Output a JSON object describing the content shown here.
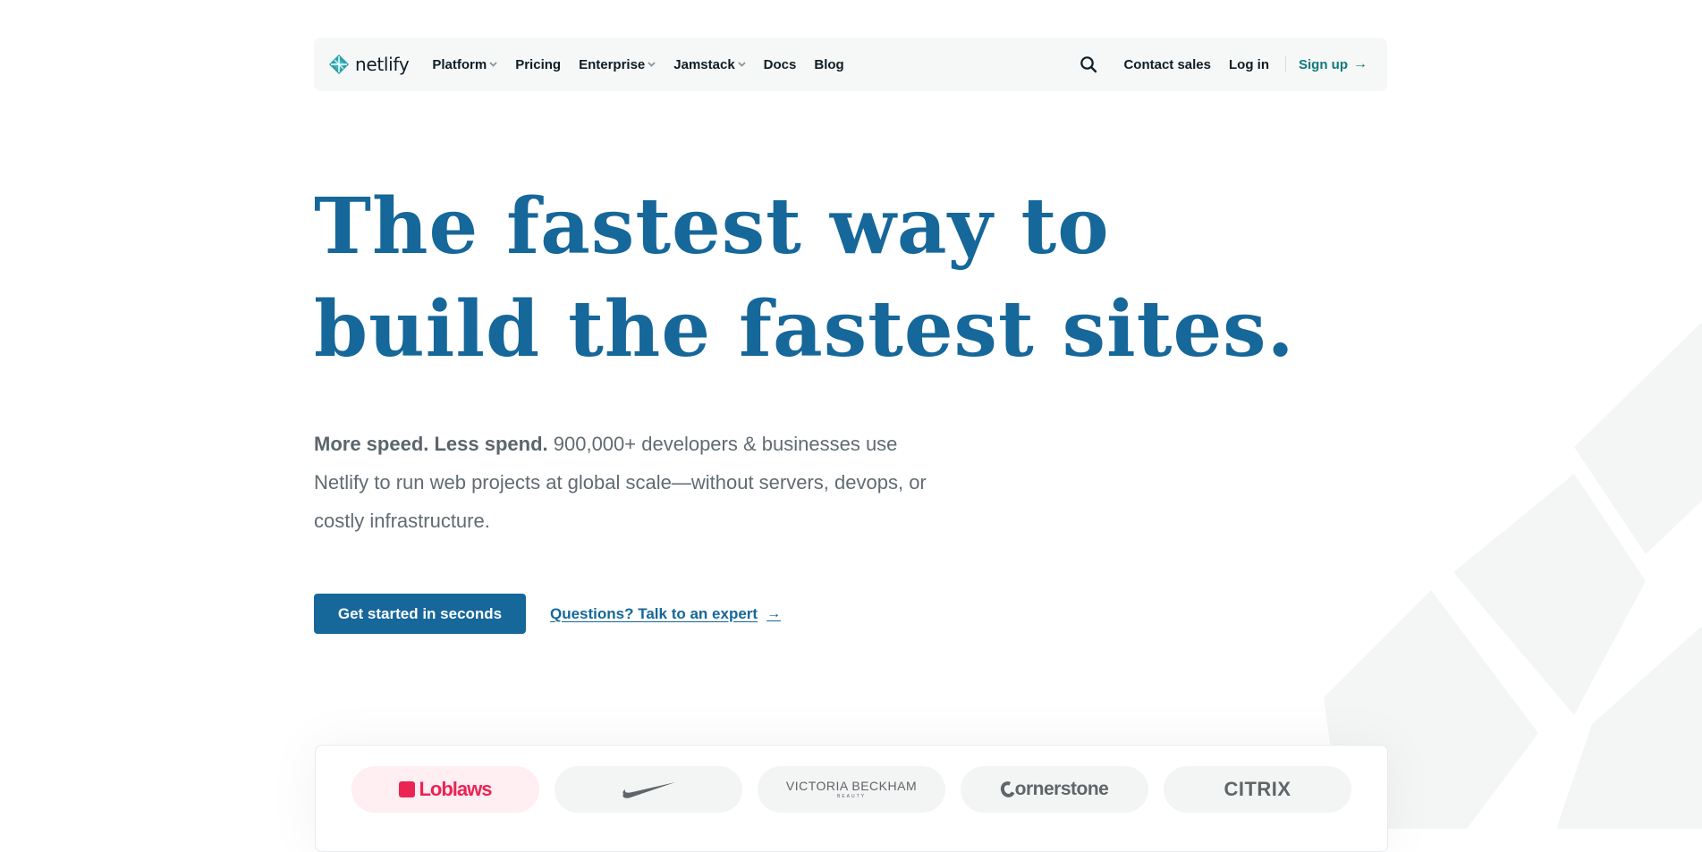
{
  "brand": {
    "name": "netlify",
    "primary_color": "#16679a",
    "teal_color": "#107a7a",
    "logo_icon": "netlify-diamond-icon"
  },
  "nav": {
    "items": [
      {
        "label": "Platform",
        "has_dropdown": true
      },
      {
        "label": "Pricing",
        "has_dropdown": false
      },
      {
        "label": "Enterprise",
        "has_dropdown": true
      },
      {
        "label": "Jamstack",
        "has_dropdown": true
      },
      {
        "label": "Docs",
        "has_dropdown": false
      },
      {
        "label": "Blog",
        "has_dropdown": false
      }
    ],
    "search_icon": "search-icon",
    "contact_sales": "Contact sales",
    "log_in": "Log in",
    "sign_up": "Sign up",
    "sign_up_arrow": "→"
  },
  "hero": {
    "title_line1": "The fastest way to",
    "title_line2": "build the fastest sites.",
    "subtitle_bold": "More speed. Less spend.",
    "subtitle_rest": " 900,000+ developers & businesses use Netlify to run web projects at global scale—without servers, devops, or costly infrastructure.",
    "cta_primary": "Get started in seconds",
    "cta_secondary": "Questions? Talk to an expert",
    "cta_secondary_arrow": "→"
  },
  "customers": {
    "logos": [
      {
        "name": "Loblaws",
        "active": true
      },
      {
        "name": "Nike",
        "active": false
      },
      {
        "name": "VICTORIA BECKHAM",
        "sub": "BEAUTY",
        "active": false
      },
      {
        "name": "ornerstone",
        "active": false
      },
      {
        "name": "CITRIX",
        "active": false
      }
    ],
    "active_color": "#ec2453"
  }
}
